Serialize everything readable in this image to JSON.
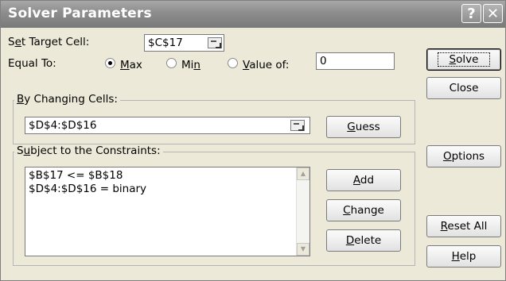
{
  "dialog": {
    "title": "Solver Parameters",
    "help_glyph": "?",
    "close_glyph": "✕"
  },
  "target": {
    "label_pre": "S",
    "label_key": "e",
    "label_post": "t Target Cell:",
    "value": "$C$17"
  },
  "equal_to": {
    "label": "Equal To:",
    "options": [
      {
        "pre": "",
        "key": "M",
        "post": "ax",
        "selected": true
      },
      {
        "pre": "Mi",
        "key": "n",
        "post": "",
        "selected": false
      },
      {
        "pre": "",
        "key": "V",
        "post": "alue of:",
        "selected": false
      }
    ],
    "value_of": "0"
  },
  "changing": {
    "label_key": "B",
    "label_post": "y Changing Cells:",
    "value": "$D$4:$D$16",
    "guess_key": "G",
    "guess_post": "uess"
  },
  "constraints": {
    "label_pre": "S",
    "label_key": "u",
    "label_post": "bject to the Constraints:",
    "items": [
      "$B$17 <= $B$18",
      "$D$4:$D$16 = binary"
    ],
    "add": {
      "key": "A",
      "post": "dd"
    },
    "change": {
      "key": "C",
      "post": "hange"
    },
    "delete": {
      "key": "D",
      "post": "elete"
    }
  },
  "buttons": {
    "solve": {
      "key": "S",
      "post": "olve"
    },
    "close": "Close",
    "options": {
      "key": "O",
      "post": "ptions"
    },
    "reset": {
      "key": "R",
      "post": "eset All"
    },
    "help": {
      "key": "H",
      "post": "elp"
    }
  }
}
